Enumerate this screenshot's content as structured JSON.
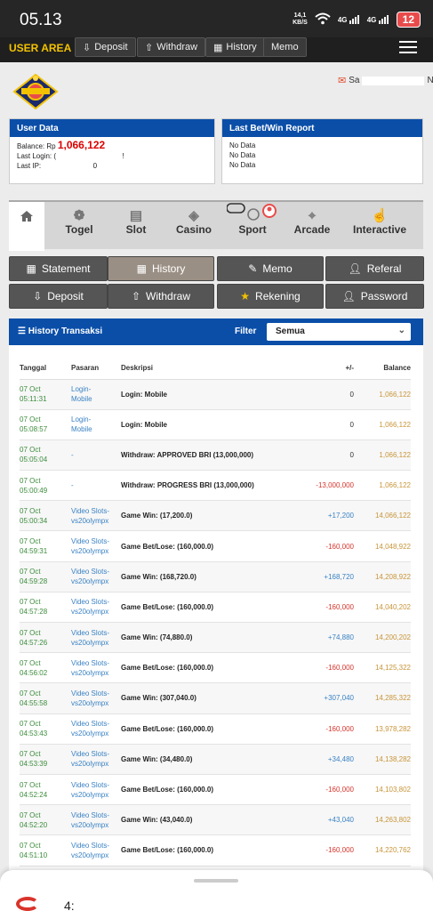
{
  "status_bar": {
    "time": "05.13",
    "net_speed_top": "14,1",
    "net_speed_bottom": "KB/S",
    "sig1": "4G",
    "sig2": "4G",
    "battery": "12"
  },
  "topnav": {
    "user_area": "USER AREA",
    "deposit": "Deposit",
    "withdraw": "Withdraw",
    "history": "History",
    "memo": "Memo"
  },
  "header": {
    "user_prefix": "Sa",
    "user_suffix": "N"
  },
  "user_data": {
    "title": "User Data",
    "balance_label": "Balance: Rp",
    "balance_value": "1,066,122",
    "last_login_label": "Last Login: (",
    "last_login_tail": "!",
    "last_ip_label": "Last IP:",
    "last_ip_value": "0"
  },
  "last_bet": {
    "title": "Last Bet/Win Report",
    "line1": "No Data",
    "line2": "No Data",
    "line3": "No Data"
  },
  "categories": {
    "togel": "Togel",
    "slot": "Slot",
    "casino": "Casino",
    "sport": "Sport",
    "arcade": "Arcade",
    "interactive": "Interactive"
  },
  "buttons": {
    "statement": "Statement",
    "history": "History",
    "memo": "Memo",
    "referal": "Referal",
    "deposit": "Deposit",
    "withdraw": "Withdraw",
    "rekening": "Rekening",
    "password": "Password"
  },
  "history": {
    "title": "History Transaksi",
    "filter_label": "Filter",
    "filter_value": "Semua",
    "columns": {
      "tanggal": "Tanggal",
      "pasaran": "Pasaran",
      "deskripsi": "Deskripsi",
      "amount": "+/-",
      "balance": "Balance"
    },
    "rows": [
      {
        "d1": "07 Oct",
        "d2": "05:11:31",
        "p1": "Login-",
        "p2": "Mobile",
        "desc": "Login: Mobile",
        "amt": "0",
        "sign": "zero",
        "bal": "1,066,122"
      },
      {
        "d1": "07 Oct",
        "d2": "05:08:57",
        "p1": "Login-",
        "p2": "Mobile",
        "desc": "Login: Mobile",
        "amt": "0",
        "sign": "zero",
        "bal": "1,066,122"
      },
      {
        "d1": "07 Oct",
        "d2": "05:05:04",
        "p1": "-",
        "p2": "",
        "desc": "Withdraw: APPROVED BRI (13,000,000)",
        "amt": "0",
        "sign": "zero",
        "bal": "1,066,122"
      },
      {
        "d1": "07 Oct",
        "d2": "05:00:49",
        "p1": "-",
        "p2": "",
        "desc": "Withdraw: PROGRESS BRI (13,000,000)",
        "amt": "-13,000,000",
        "sign": "neg",
        "bal": "1,066,122"
      },
      {
        "d1": "07 Oct",
        "d2": "05:00:34",
        "p1": "Video Slots-",
        "p2": "vs20olympx",
        "desc": "Game Win: (17,200.0)",
        "amt": "+17,200",
        "sign": "pos",
        "bal": "14,066,122"
      },
      {
        "d1": "07 Oct",
        "d2": "04:59:31",
        "p1": "Video Slots-",
        "p2": "vs20olympx",
        "desc": "Game Bet/Lose: (160,000.0)",
        "amt": "-160,000",
        "sign": "neg",
        "bal": "14,048,922"
      },
      {
        "d1": "07 Oct",
        "d2": "04:59:28",
        "p1": "Video Slots-",
        "p2": "vs20olympx",
        "desc": "Game Win: (168,720.0)",
        "amt": "+168,720",
        "sign": "pos",
        "bal": "14,208,922"
      },
      {
        "d1": "07 Oct",
        "d2": "04:57:28",
        "p1": "Video Slots-",
        "p2": "vs20olympx",
        "desc": "Game Bet/Lose: (160,000.0)",
        "amt": "-160,000",
        "sign": "neg",
        "bal": "14,040,202"
      },
      {
        "d1": "07 Oct",
        "d2": "04:57:26",
        "p1": "Video Slots-",
        "p2": "vs20olympx",
        "desc": "Game Win: (74,880.0)",
        "amt": "+74,880",
        "sign": "pos",
        "bal": "14,200,202"
      },
      {
        "d1": "07 Oct",
        "d2": "04:56:02",
        "p1": "Video Slots-",
        "p2": "vs20olympx",
        "desc": "Game Bet/Lose: (160,000.0)",
        "amt": "-160,000",
        "sign": "neg",
        "bal": "14,125,322"
      },
      {
        "d1": "07 Oct",
        "d2": "04:55:58",
        "p1": "Video Slots-",
        "p2": "vs20olympx",
        "desc": "Game Win: (307,040.0)",
        "amt": "+307,040",
        "sign": "pos",
        "bal": "14,285,322"
      },
      {
        "d1": "07 Oct",
        "d2": "04:53:43",
        "p1": "Video Slots-",
        "p2": "vs20olympx",
        "desc": "Game Bet/Lose: (160,000.0)",
        "amt": "-160,000",
        "sign": "neg",
        "bal": "13,978,282"
      },
      {
        "d1": "07 Oct",
        "d2": "04:53:39",
        "p1": "Video Slots-",
        "p2": "vs20olympx",
        "desc": "Game Win: (34,480.0)",
        "amt": "+34,480",
        "sign": "pos",
        "bal": "14,138,282"
      },
      {
        "d1": "07 Oct",
        "d2": "04:52:24",
        "p1": "Video Slots-",
        "p2": "vs20olympx",
        "desc": "Game Bet/Lose: (160,000.0)",
        "amt": "-160,000",
        "sign": "neg",
        "bal": "14,103,802"
      },
      {
        "d1": "07 Oct",
        "d2": "04:52:20",
        "p1": "Video Slots-",
        "p2": "vs20olympx",
        "desc": "Game Win: (43,040.0)",
        "amt": "+43,040",
        "sign": "pos",
        "bal": "14,263,802"
      },
      {
        "d1": "07 Oct",
        "d2": "04:51:10",
        "p1": "Video Slots-",
        "p2": "vs20olympx",
        "desc": "Game Bet/Lose: (160,000.0)",
        "amt": "-160,000",
        "sign": "neg",
        "bal": "14,220,762"
      }
    ]
  },
  "sheet": {
    "text": "4:"
  },
  "colors": {
    "primary_blue": "#0a4ea8",
    "gold": "#f2c200",
    "negative": "#d9342b",
    "positive": "#3a82c4",
    "balance": "#c8953a"
  }
}
